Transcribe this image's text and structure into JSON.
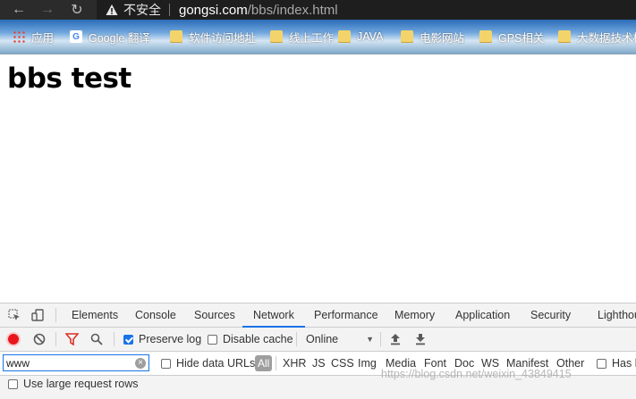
{
  "browser": {
    "security_label": "不安全",
    "url_host": "gongsi.com",
    "url_path": "/bbs/index.html"
  },
  "bookmarks": [
    {
      "label": "应用",
      "icon": "apps-grid-icon"
    },
    {
      "label": "Google 翻译",
      "icon": "google-translate-icon"
    },
    {
      "label": "软件访问地址",
      "icon": "folder-icon"
    },
    {
      "label": "线上工作",
      "icon": "folder-icon"
    },
    {
      "label": "JAVA",
      "icon": "folder-icon"
    },
    {
      "label": "电影网站",
      "icon": "folder-icon"
    },
    {
      "label": "GPS相关",
      "icon": "folder-icon"
    },
    {
      "label": "大数据技术栈",
      "icon": "folder-icon"
    }
  ],
  "page": {
    "heading": "bbs test"
  },
  "devtools": {
    "tabs": [
      "Elements",
      "Console",
      "Sources",
      "Network",
      "Performance",
      "Memory",
      "Application",
      "Security",
      "Lighthouse"
    ],
    "active_tab": "Network",
    "preserve_log_label": "Preserve log",
    "preserve_log_checked": true,
    "disable_cache_label": "Disable cache",
    "disable_cache_checked": false,
    "throttling_value": "Online",
    "filter_value": "www",
    "hide_data_urls_label": "Hide data URLs",
    "type_filters": [
      "All",
      "XHR",
      "JS",
      "CSS",
      "Img",
      "Media",
      "Font",
      "Doc",
      "WS",
      "Manifest",
      "Other"
    ],
    "has_blocked_label": "Has b",
    "large_rows_label": "Use large request rows",
    "accent_color": "#1a73e8"
  },
  "watermark": "https://blog.csdn.net/weixin_43849415"
}
